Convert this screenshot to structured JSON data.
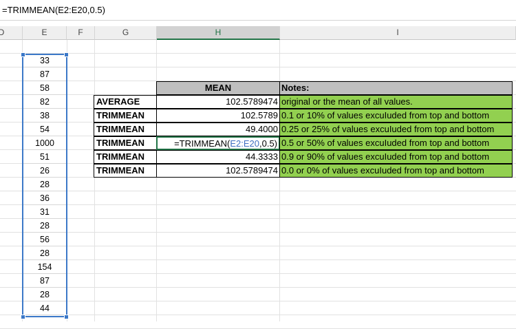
{
  "formula_bar": {
    "text": "=TRIMMEAN(E2:E20,0.5)"
  },
  "columns": [
    {
      "label": "D",
      "selected": false
    },
    {
      "label": "E",
      "selected": false
    },
    {
      "label": "F",
      "selected": false
    },
    {
      "label": "G",
      "selected": false
    },
    {
      "label": "H",
      "selected": true
    },
    {
      "label": "I",
      "selected": false
    }
  ],
  "column_e_values": [
    "33",
    "87",
    "58",
    "82",
    "38",
    "54",
    "1000",
    "51",
    "26",
    "28",
    "36",
    "31",
    "28",
    "56",
    "28",
    "154",
    "87",
    "28",
    "44"
  ],
  "table": {
    "header": {
      "mean": "MEAN",
      "notes": "Notes:"
    },
    "rows": [
      {
        "label": "AVERAGE",
        "value": "102.5789474",
        "note": "original or the mean of all values."
      },
      {
        "label": "TRIMMEAN",
        "value": "102.5789",
        "note": "0.1 or 10% of values excuIuded from top and bottom"
      },
      {
        "label": "TRIMMEAN",
        "value": "49.4000",
        "note": "0.25 or 25% of values excuIuded from top and bottom"
      },
      {
        "label": "TRIMMEAN",
        "value": "=TRIMMEAN(E2:E20,0.5)",
        "note": "0.5 or 50% of values excuIuded from top and bottom"
      },
      {
        "label": "TRIMMEAN",
        "value": "44.3333",
        "note": "0.9 or 90% of values excuIuded from top and bottom"
      },
      {
        "label": "TRIMMEAN",
        "value": "102.5789474",
        "note": "0.0 or 0% of values excuIuded from top and bottom"
      }
    ]
  },
  "colors": {
    "notes_fill": "#92d050",
    "header_fill": "#bfbfbf",
    "selection": "#3b78c8",
    "active_cell": "#217346"
  }
}
